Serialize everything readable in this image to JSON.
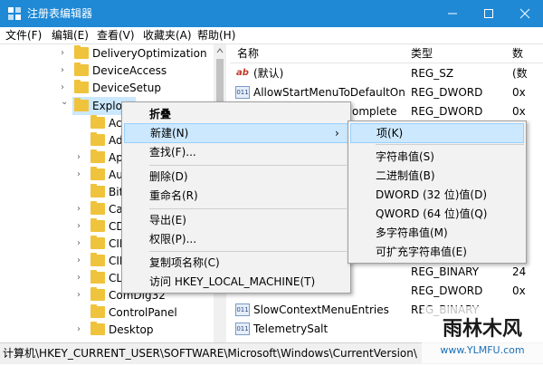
{
  "window": {
    "title": "注册表编辑器",
    "buttons": [
      "minimize",
      "maximize",
      "close"
    ]
  },
  "menu": [
    "文件(F)",
    "编辑(E)",
    "查看(V)",
    "收藏夹(A)",
    "帮助(H)"
  ],
  "tree": {
    "items": [
      {
        "label": "DeliveryOptimization"
      },
      {
        "label": "DeviceAccess"
      },
      {
        "label": "DeviceSetup"
      },
      {
        "label": "Explor"
      },
      {
        "label": "Ac"
      },
      {
        "label": "Ad"
      },
      {
        "label": "Ap"
      },
      {
        "label": "Au"
      },
      {
        "label": "Bit"
      },
      {
        "label": "Ca"
      },
      {
        "label": "CD"
      },
      {
        "label": "CII"
      },
      {
        "label": "CII"
      },
      {
        "label": "CL"
      },
      {
        "label": "ComDlg32"
      },
      {
        "label": "ControlPanel"
      },
      {
        "label": "Desktop"
      }
    ]
  },
  "list": {
    "headers": {
      "name": "名称",
      "type": "类型",
      "data": "数"
    },
    "rows": [
      {
        "name": "(默认)",
        "type": "REG_SZ",
        "data": "(数",
        "icon": "string-value-icon"
      },
      {
        "name": "AllowStartMenuToDefaultOn",
        "type": "REG_DWORD",
        "data": "0x",
        "icon": "binary-value-icon"
      },
      {
        "name": "omplete",
        "type": "REG_DWORD",
        "data": "0x",
        "icon": "binary-value-icon"
      },
      {
        "name": "",
        "type": "REG_BINARY",
        "data": "24",
        "icon": "binary-value-icon"
      },
      {
        "name": "",
        "type": "REG_DWORD",
        "data": "0x",
        "icon": "binary-value-icon"
      },
      {
        "name": "SlowContextMenuEntries",
        "type": "REG_BINARY",
        "data": "",
        "icon": "binary-value-icon"
      },
      {
        "name": "TelemetrySalt",
        "type": "",
        "data": "",
        "icon": "binary-value-icon"
      }
    ]
  },
  "context_menu": {
    "items": [
      "折叠",
      "新建(N)",
      "查找(F)...",
      "删除(D)",
      "重命名(R)",
      "导出(E)",
      "权限(P)...",
      "复制项名称(C)",
      "访问 HKEY_LOCAL_MACHINE(T)"
    ],
    "submenu_arrow": "›"
  },
  "submenu": {
    "items": [
      "项(K)",
      "字符串值(S)",
      "二进制值(B)",
      "DWORD (32 位)值(D)",
      "QWORD (64 位)值(Q)",
      "多字符串值(M)",
      "可扩充字符串值(E)"
    ]
  },
  "statusbar": {
    "path": "计算机\\HKEY_CURRENT_USER\\SOFTWARE\\Microsoft\\Windows\\CurrentVersion\\"
  },
  "watermark": {
    "text": "雨林木风",
    "url": "www.YLMFU.com"
  },
  "colors": {
    "titlebar": "#1f89d6",
    "highlight": "#cce8ff",
    "folder": "#f0c33c"
  }
}
